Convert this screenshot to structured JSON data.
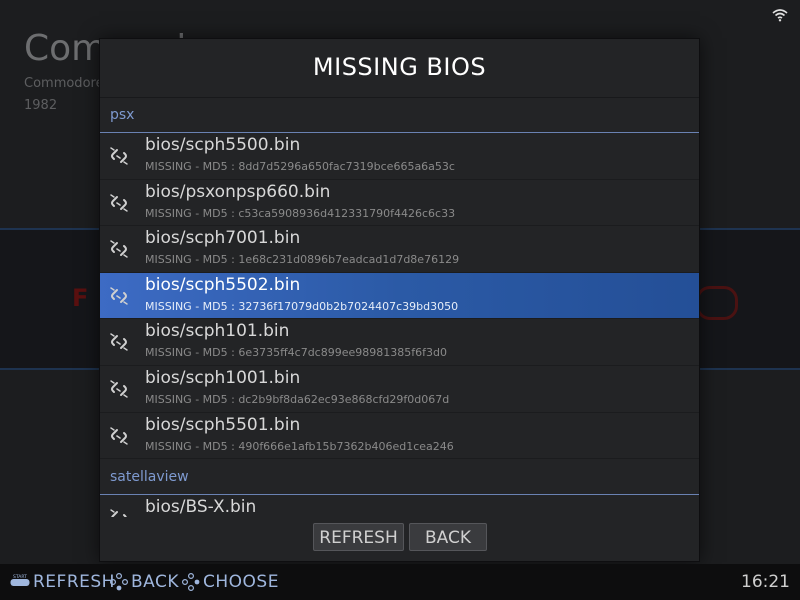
{
  "background": {
    "system_title": "Commodore",
    "manufacturer": "Commodore",
    "year": "1982"
  },
  "dialog": {
    "title": "MISSING BIOS",
    "groups": [
      {
        "name": "psx",
        "files": [
          {
            "path": "bios/scph5500.bin",
            "detail": "MISSING - MD5 : 8dd7d5296a650fac7319bce665a6a53c"
          },
          {
            "path": "bios/psxonpsp660.bin",
            "detail": "MISSING - MD5 : c53ca5908936d412331790f4426c6c33"
          },
          {
            "path": "bios/scph7001.bin",
            "detail": "MISSING - MD5 : 1e68c231d0896b7eadcad1d7d8e76129"
          },
          {
            "path": "bios/scph5502.bin",
            "detail": "MISSING - MD5 : 32736f17079d0b2b7024407c39bd3050"
          },
          {
            "path": "bios/scph101.bin",
            "detail": "MISSING - MD5 : 6e3735ff4c7dc899ee98981385f6f3d0"
          },
          {
            "path": "bios/scph1001.bin",
            "detail": "MISSING - MD5 : dc2b9bf8da62ec93e868cfd29f0d067d"
          },
          {
            "path": "bios/scph5501.bin",
            "detail": "MISSING - MD5 : 490f666e1afb15b7362b406ed1cea246"
          }
        ]
      },
      {
        "name": "satellaview",
        "files": [
          {
            "path": "bios/BS-X.bin",
            "detail": ""
          }
        ]
      }
    ],
    "buttons": {
      "refresh": "REFRESH",
      "back": "BACK"
    }
  },
  "help_bar": {
    "start_icon_text": "START",
    "refresh": "REFRESH",
    "back": "BACK",
    "choose": "CHOOSE"
  },
  "clock": "16:21",
  "colors": {
    "accent": "#7e9ad0",
    "selection": "#2b5aa6",
    "help_text": "#9fb6dd"
  },
  "icons": [
    "wifi-icon",
    "broken-link-icon",
    "start-button-icon",
    "dpad-icon"
  ]
}
